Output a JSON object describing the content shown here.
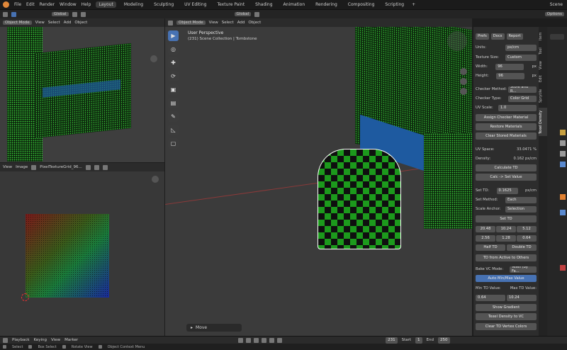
{
  "menu": {
    "items": [
      "File",
      "Edit",
      "Render",
      "Window",
      "Help"
    ]
  },
  "workspaces": {
    "tabs": [
      "Layout",
      "Modeling",
      "Sculpting",
      "UV Editing",
      "Texture Paint",
      "Shading",
      "Animation",
      "Rendering",
      "Compositing",
      "Scripting"
    ],
    "active": "Layout",
    "add": "+"
  },
  "scene": {
    "label": "Scene"
  },
  "toolbar": {
    "transform_label": "Global",
    "options_label": "Options"
  },
  "left_viewport": {
    "mode": "Object Mode",
    "menus": [
      "View",
      "Select",
      "Add",
      "Object"
    ]
  },
  "uv_editor": {
    "menus": [
      "View",
      "Image"
    ],
    "image_name": "PixelTextureGrid_96..."
  },
  "main_viewport": {
    "mode": "Object Mode",
    "menus": [
      "View",
      "Select",
      "Add",
      "Object"
    ],
    "overlay_title": "User Perspective",
    "overlay_sub": "(231) Scene Collection | Tombstone",
    "move_label": "Move"
  },
  "panel": {
    "tabs": [
      "Prefs",
      "Docs",
      "Report"
    ],
    "units_label": "Units:",
    "units_value": "px/cm",
    "texsize_label": "Texture Size:",
    "texsize_value": "Custom",
    "width_label": "Width:",
    "width_value": "96",
    "width_unit": "px",
    "height_label": "Height:",
    "height_value": "96",
    "height_unit": "px",
    "checker_method_label": "Checker Method:",
    "checker_method_value": "Store and R...",
    "checker_type_label": "Checker Type:",
    "checker_type_value": "Color Grid",
    "uvscale_label": "UV Scale:",
    "uvscale_value": "1.0",
    "assign_checker": "Assign Checker Material",
    "restore_materials": "Restore Materials",
    "clear_stored": "Clear Stored Materials",
    "uvspace_label": "UV Space:",
    "uvspace_value": "33.0471 %",
    "density_label": "Density:",
    "density_value": "0.162 px/cm",
    "calculate_td": "Calculate TD",
    "calc_set": "Calc -> Set Value",
    "settd_label": "Set TD:",
    "settd_value": "0.1625",
    "settd_unit": "px/cm",
    "setmethod_label": "Set Method:",
    "setmethod_value": "Each",
    "anchor_label": "Scale Anchor:",
    "anchor_value": "Selection",
    "set_td": "Set TD",
    "presets_row1": [
      "20.48",
      "10.24",
      "5.12"
    ],
    "presets_row2": [
      "2.56",
      "1.28",
      "0.64"
    ],
    "half_td": "Half TD",
    "double_td": "Double TD",
    "td_active_to_others": "TD from Active to Others",
    "bakevc_label": "Bake VC Mode:",
    "bakevc_value": "Texel (by Fa...",
    "auto_minmax": "Auto Min/Max Value",
    "min_label": "Min TD Value:",
    "max_label": "Max TD Value:",
    "min_value": "0.64",
    "max_value": "10.24",
    "show_gradient": "Show Gradient",
    "texel_to_vc": "Texel Density to VC",
    "clear_vc": "Clear TD Vertex Colors"
  },
  "side_tabs": [
    "Item",
    "Tool",
    "View",
    "Edit",
    "Sprytile",
    "Texel Density"
  ],
  "timeline": {
    "menus": [
      "Playback",
      "Keying",
      "View",
      "Marker"
    ],
    "current": "231",
    "start_label": "Start",
    "start": "1",
    "end_label": "End",
    "end": "250"
  },
  "statusbar": {
    "items": [
      "Select",
      "Box Select",
      "Rotate View",
      "Object Context Menu"
    ]
  },
  "colors": {
    "accent": "#4772b3",
    "active_workspace": "#3d3d3d",
    "bg": "#3b3b3b"
  }
}
